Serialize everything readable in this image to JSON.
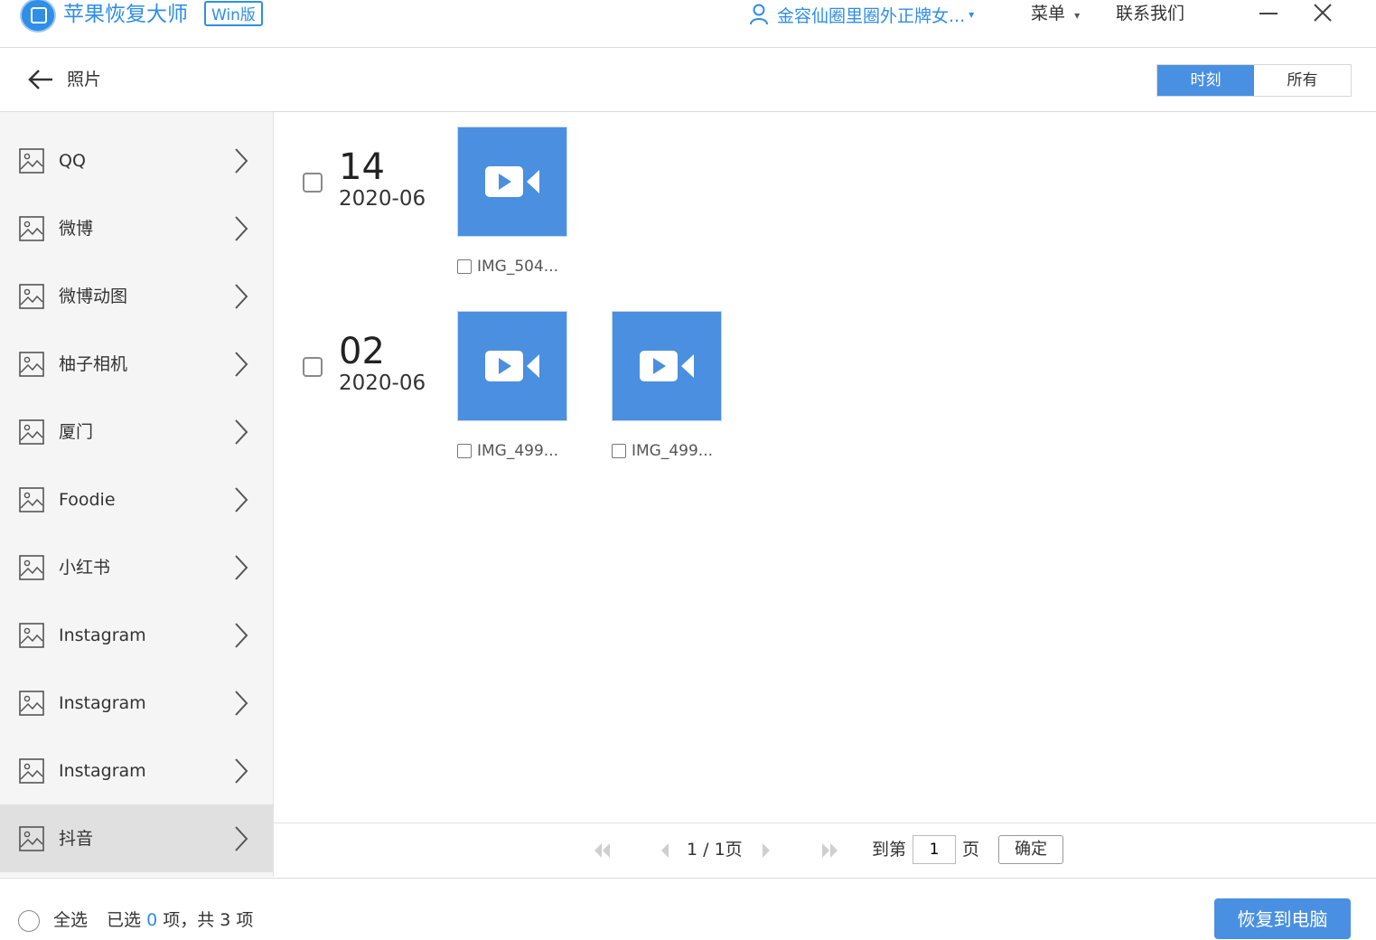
{
  "titlebar": {
    "app_name": "苹果恢复大师",
    "edition_badge": "Win版",
    "user_name": "金容仙圈里圈外正牌女...",
    "user_caret": "▾",
    "menu_label": "菜单",
    "menu_caret": "▾",
    "contact_label": "联系我们",
    "minimize_icon": "minimize-icon",
    "close_icon": "close-icon"
  },
  "subheader": {
    "title": "照片",
    "view_tabs": [
      {
        "label": "时刻",
        "active": true
      },
      {
        "label": "所有",
        "active": false
      }
    ]
  },
  "sidebar": {
    "items": [
      {
        "label": "QQ"
      },
      {
        "label": "微博"
      },
      {
        "label": "微博动图"
      },
      {
        "label": "柚子相机"
      },
      {
        "label": "厦门"
      },
      {
        "label": "Foodie"
      },
      {
        "label": "小红书"
      },
      {
        "label": "Instagram"
      },
      {
        "label": "Instagram"
      },
      {
        "label": "Instagram"
      },
      {
        "label": "抖音",
        "active": true
      }
    ]
  },
  "content": {
    "groups": [
      {
        "day": "14",
        "month": "2020-06",
        "items": [
          {
            "name": "IMG_504..."
          }
        ]
      },
      {
        "day": "02",
        "month": "2020-06",
        "items": [
          {
            "name": "IMG_499..."
          },
          {
            "name": "IMG_499..."
          }
        ]
      }
    ]
  },
  "pager": {
    "page_info": "1 / 1页",
    "goto_prefix": "到第",
    "goto_value": "1",
    "goto_suffix": "页",
    "confirm_label": "确定"
  },
  "bottom": {
    "select_all_label": "全选",
    "selected_prefix": "已选",
    "selected_count": "0",
    "selected_middle": "项，共",
    "total_count": "3",
    "total_suffix": "项",
    "recover_label": "恢复到电脑"
  },
  "colors": {
    "accent": "#4a90e2",
    "brand_text": "#2f8ee6",
    "active_sidebar_bg": "#e0e0e0"
  }
}
